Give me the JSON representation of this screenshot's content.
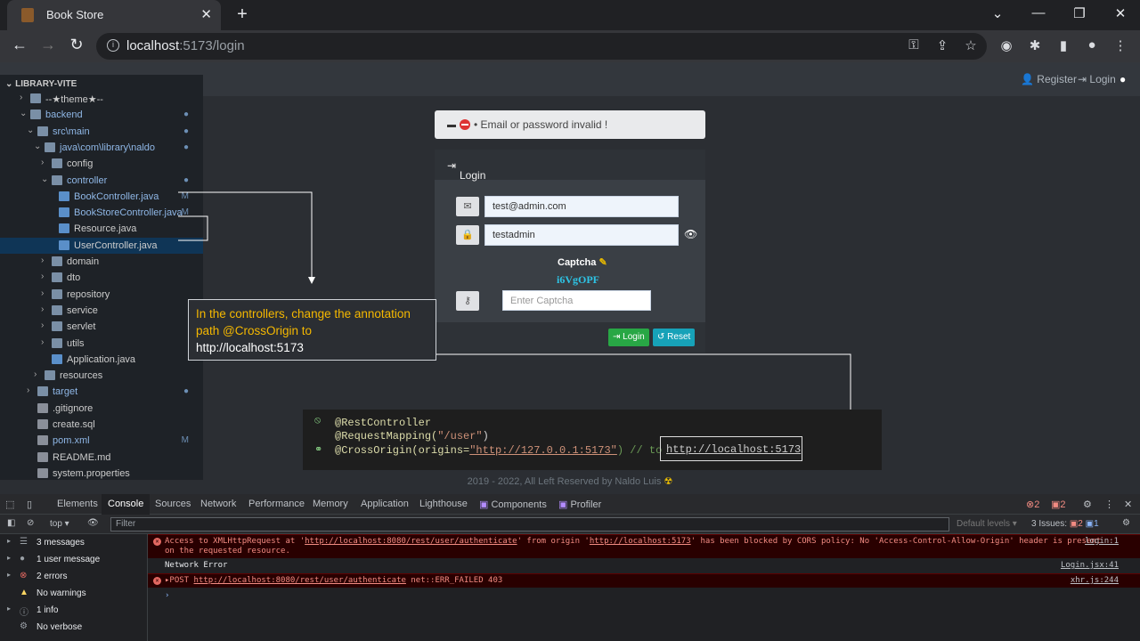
{
  "browser": {
    "tab_title": "Book Store",
    "url_host": "localhost",
    "url_rest": ":5173/login"
  },
  "site": {
    "nav_register": "Register",
    "nav_login": "Login",
    "alert_text": "• Email or password invalid !",
    "card_title": "Login",
    "email_value": "test@admin.com",
    "password_value": "testadmin",
    "captcha_label": "Captcha",
    "captcha_code": "i6VgOPF",
    "captcha_placeholder": "Enter Captcha",
    "login_button": "Login",
    "reset_button": "Reset",
    "footer": "2019 - 2022, All Left Reserved by Naldo Luis"
  },
  "explorer": {
    "title": "LIBRARY-VITE",
    "items": [
      {
        "label": "--★theme★--",
        "indent": 1,
        "chev": "›",
        "mark": ""
      },
      {
        "label": "backend",
        "indent": 1,
        "chev": "⌄",
        "mark": "●"
      },
      {
        "label": "src\\main",
        "indent": 2,
        "chev": "⌄",
        "mark": "●"
      },
      {
        "label": "java\\com\\library\\naldo",
        "indent": 3,
        "chev": "⌄",
        "mark": "●"
      },
      {
        "label": "config",
        "indent": 4,
        "chev": "›",
        "mark": ""
      },
      {
        "label": "controller",
        "indent": 4,
        "chev": "⌄",
        "mark": "●"
      },
      {
        "label": "BookController.java",
        "indent": 5,
        "chev": "",
        "mark": "M"
      },
      {
        "label": "BookStoreController.java",
        "indent": 5,
        "chev": "",
        "mark": "M"
      },
      {
        "label": "Resource.java",
        "indent": 5,
        "chev": "",
        "mark": ""
      },
      {
        "label": "UserController.java",
        "indent": 5,
        "chev": "",
        "mark": ""
      },
      {
        "label": "domain",
        "indent": 4,
        "chev": "›",
        "mark": ""
      },
      {
        "label": "dto",
        "indent": 4,
        "chev": "›",
        "mark": ""
      },
      {
        "label": "repository",
        "indent": 4,
        "chev": "›",
        "mark": ""
      },
      {
        "label": "service",
        "indent": 4,
        "chev": "›",
        "mark": ""
      },
      {
        "label": "servlet",
        "indent": 4,
        "chev": "›",
        "mark": ""
      },
      {
        "label": "utils",
        "indent": 4,
        "chev": "›",
        "mark": ""
      },
      {
        "label": "Application.java",
        "indent": 4,
        "chev": "",
        "mark": ""
      },
      {
        "label": "resources",
        "indent": 3,
        "chev": "›",
        "mark": ""
      },
      {
        "label": "target",
        "indent": 2,
        "chev": "›",
        "mark": "●"
      },
      {
        "label": ".gitignore",
        "indent": 2,
        "chev": "",
        "mark": ""
      },
      {
        "label": "create.sql",
        "indent": 2,
        "chev": "",
        "mark": ""
      },
      {
        "label": "pom.xml",
        "indent": 2,
        "chev": "",
        "mark": "M"
      },
      {
        "label": "README.md",
        "indent": 2,
        "chev": "",
        "mark": ""
      },
      {
        "label": "system.properties",
        "indent": 2,
        "chev": "",
        "mark": ""
      }
    ]
  },
  "callout": {
    "text": "In the controllers, change the annotation path @CrossOrigin to",
    "url": "http://localhost:5173"
  },
  "code": {
    "line1": "@RestController",
    "line2_a": "@RequestMapping(",
    "line2_b": "\"/user\"",
    "line2_c": ")",
    "line3_a": "@CrossOrigin(origins=",
    "line3_b": "\"http://127.0.0.1:5173\"",
    "line3_c": ") // to",
    "boxed": "http://localhost:5173"
  },
  "devtools": {
    "tabs": [
      "Elements",
      "Console",
      "Sources",
      "Network",
      "Performance",
      "Memory",
      "Application",
      "Lighthouse",
      "Components",
      "Profiler"
    ],
    "context": "top",
    "filter_placeholder": "Filter",
    "levels": "Default levels",
    "issues_label": "3 Issues:",
    "issues_err": "2",
    "issues_info": "1",
    "err_count": "2",
    "warn_count": "2",
    "sidebar": [
      "3 messages",
      "1 user message",
      "2 errors",
      "No warnings",
      "1 info",
      "No verbose"
    ],
    "log1_a": "Access to XMLHttpRequest at '",
    "log1_url": "http://localhost:8080/rest/user/authenticate",
    "log1_b": "' from origin '",
    "log1_origin": "http://localhost:5173",
    "log1_c": "' has been blocked by CORS policy: No 'Access-Control-Allow-Origin' header is present",
    "log1_d": "on the requested resource.",
    "log1_src": "login:1",
    "log2": "Network Error",
    "log2_src": "Login.jsx:41",
    "log3_a": "▸POST ",
    "log3_url": "http://localhost:8080/rest/user/authenticate",
    "log3_b": " net::ERR_FAILED 403",
    "log3_src": "xhr.js:244"
  }
}
